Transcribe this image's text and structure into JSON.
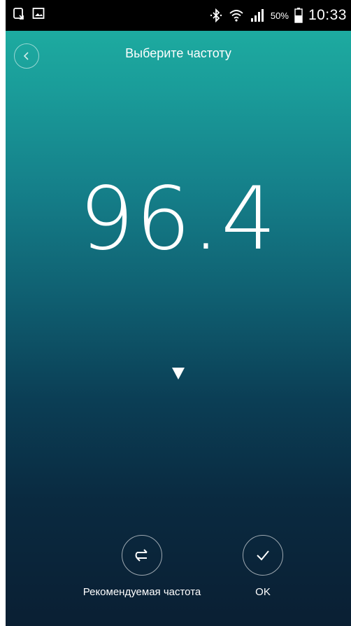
{
  "status_bar": {
    "battery_percent": "50%",
    "time": "10:33",
    "left_icons": [
      "screen-rotate-icon",
      "image-icon"
    ],
    "right_icons": [
      "bluetooth-icon",
      "wifi-icon",
      "signal-icon",
      "battery-icon"
    ]
  },
  "header": {
    "title": "Выберите частоту",
    "back_icon": "chevron-left-icon"
  },
  "tuner": {
    "frequency": "96.4",
    "pointer_icon": "triangle-down-icon"
  },
  "actions": {
    "recommended_label": "Рекомендуемая частота",
    "recommended_icon": "swap-icon",
    "ok_label": "OK",
    "ok_icon": "check-icon"
  },
  "colors": {
    "gradient_top": "#1fb2a3",
    "gradient_bottom": "#0a1f33",
    "foreground": "#ffffff"
  }
}
